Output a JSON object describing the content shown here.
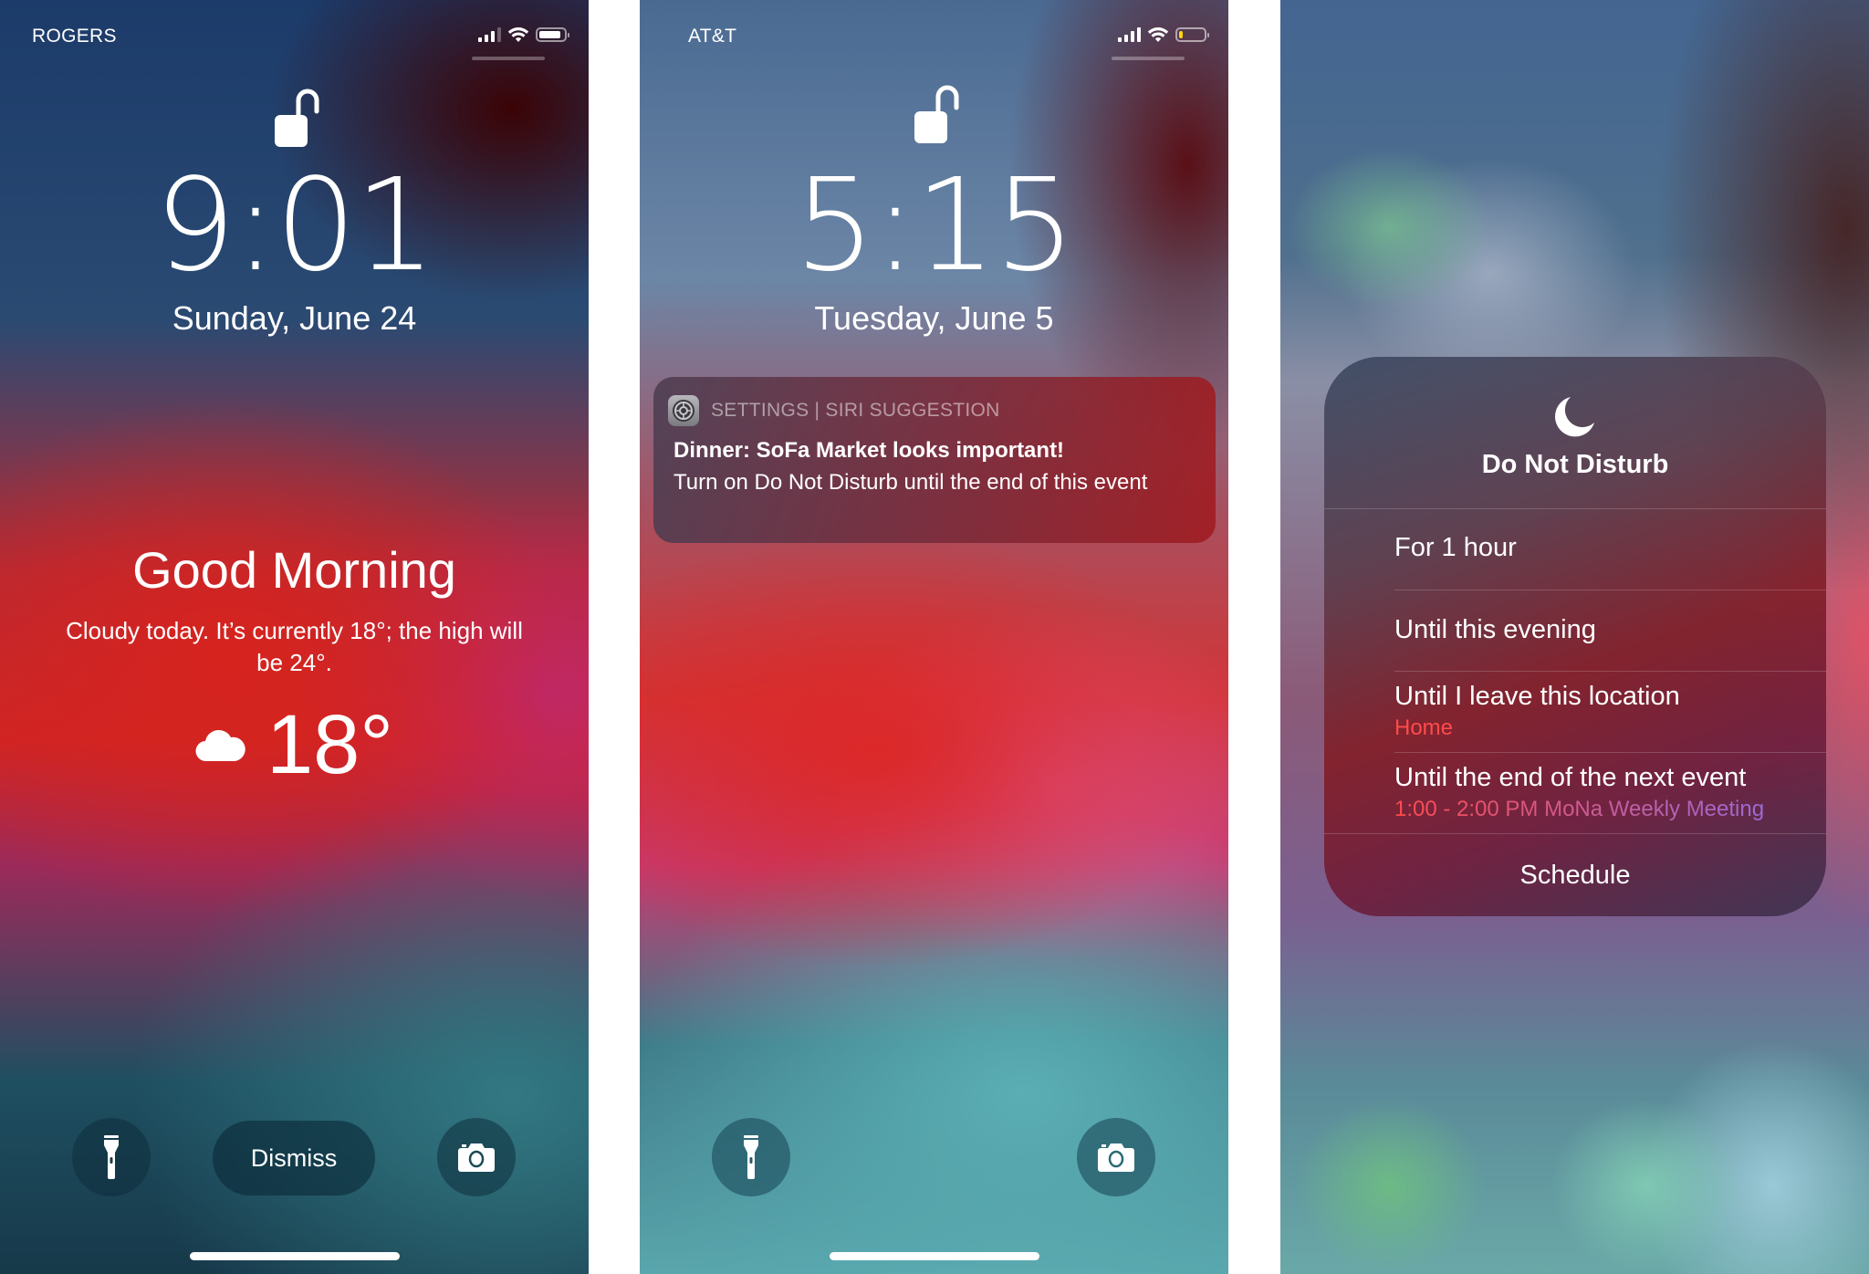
{
  "screens": [
    {
      "carrier": "ROGERS",
      "signal_bars": 3,
      "signal_max": 4,
      "battery_level": 0.9,
      "battery_color": "#ffffff",
      "time": "9:01",
      "date": "Sunday, June 24",
      "greeting": "Good Morning",
      "weather_summary": "Cloudy today. It’s currently 18°; the high will be 24°.",
      "weather_icon": "cloud-icon",
      "current_temp": "18°",
      "dismiss_label": "Dismiss",
      "left_button_icon": "flashlight-icon",
      "right_button_icon": "camera-icon"
    },
    {
      "carrier": "AT&T",
      "signal_bars": 4,
      "signal_max": 4,
      "battery_level": 0.15,
      "battery_color": "#ffd60a",
      "time": "5:15",
      "date": "Tuesday, June 5",
      "notification": {
        "app_icon": "settings-gear-icon",
        "app_label": "SETTINGS | SIRI SUGGESTION",
        "title": "Dinner: SoFa Market looks important!",
        "body": "Turn on Do Not Disturb until the end of this event"
      },
      "left_button_icon": "flashlight-icon",
      "right_button_icon": "camera-icon"
    },
    {
      "dnd_menu": {
        "icon": "moon-icon",
        "title": "Do Not Disturb",
        "options": [
          {
            "label": "For 1 hour",
            "sub": ""
          },
          {
            "label": "Until this evening",
            "sub": ""
          },
          {
            "label": "Until I leave this location",
            "sub": "Home"
          },
          {
            "label": "Until the end of the next event",
            "sub": "1:00 - 2:00 PM MoNa Weekly Meeting"
          }
        ],
        "schedule_label": "Schedule",
        "accent_sub_color": "#ff4b4b",
        "accent_sub_gradient_end": "#9b6bd6"
      }
    }
  ]
}
